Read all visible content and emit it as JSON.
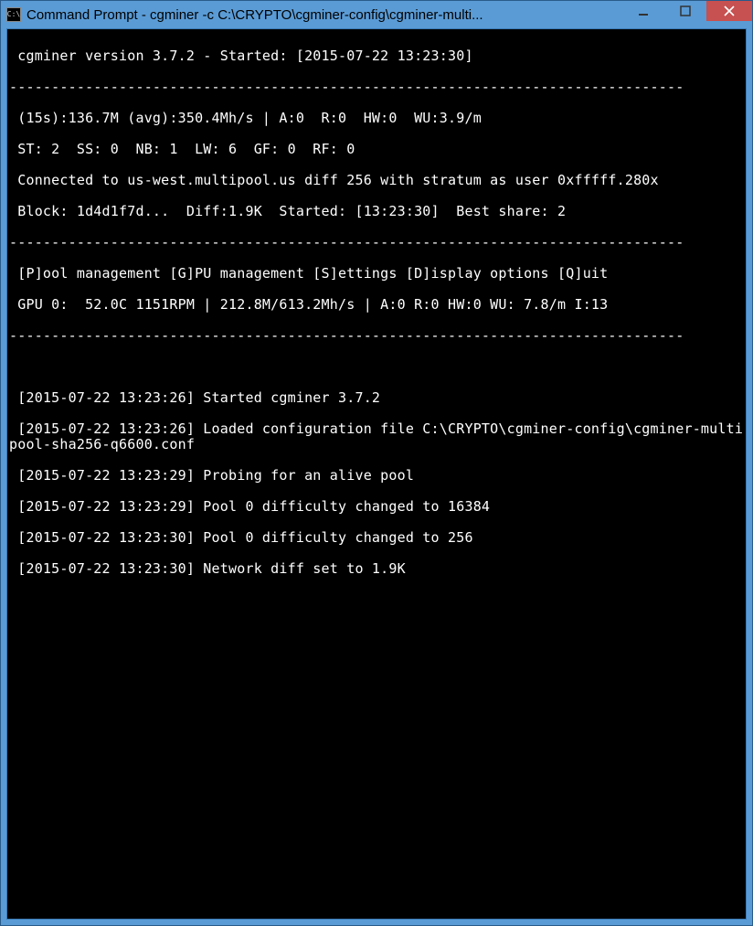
{
  "window": {
    "title": "Command Prompt - cgminer  -c C:\\CRYPTO\\cgminer-config\\cgminer-multi...",
    "app_icon_label": "C:\\"
  },
  "terminal": {
    "header": {
      "version_line": " cgminer version 3.7.2 - Started: [2015-07-22 13:23:30]",
      "dashes": "--------------------------------------------------------------------------------",
      "stats1": " (15s):136.7M (avg):350.4Mh/s | A:0  R:0  HW:0  WU:3.9/m",
      "stats2": " ST: 2  SS: 0  NB: 1  LW: 6  GF: 0  RF: 0",
      "connected": " Connected to us-west.multipool.us diff 256 with stratum as user 0xfffff.280x",
      "block": " Block: 1d4d1f7d...  Diff:1.9K  Started: [13:23:30]  Best share: 2",
      "menu": " [P]ool management [G]PU management [S]ettings [D]isplay options [Q]uit",
      "gpu0": " GPU 0:  52.0C 1151RPM | 212.8M/613.2Mh/s | A:0 R:0 HW:0 WU: 7.8/m I:13"
    },
    "log": [
      " [2015-07-22 13:23:26] Started cgminer 3.7.2",
      " [2015-07-22 13:23:26] Loaded configuration file C:\\CRYPTO\\cgminer-config\\cgminer-multipool-sha256-q6600.conf",
      " [2015-07-22 13:23:29] Probing for an alive pool",
      " [2015-07-22 13:23:29] Pool 0 difficulty changed to 16384",
      " [2015-07-22 13:23:30] Pool 0 difficulty changed to 256",
      " [2015-07-22 13:23:30] Network diff set to 1.9K"
    ]
  }
}
